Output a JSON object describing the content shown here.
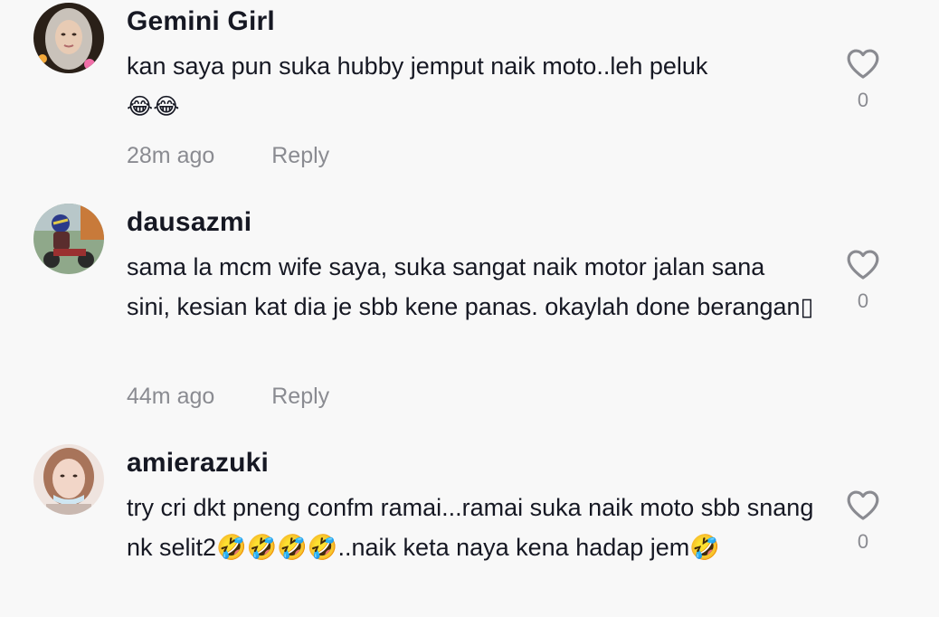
{
  "comments": [
    {
      "username": "Gemini Girl",
      "text": "kan saya pun suka hubby jemput naik moto..leh peluk",
      "emoji": "😂😂",
      "time": "28m ago",
      "reply_label": "Reply",
      "likes": "0",
      "avatar_icon": "hijab-girl-avatar"
    },
    {
      "username": "dausazmi",
      "text": "sama la mcm wife saya, suka sangat naik motor jalan sana sini, kesian kat dia je sbb kene panas. okaylah done berangan▯",
      "emoji": "",
      "time": "44m ago",
      "reply_label": "Reply",
      "likes": "0",
      "avatar_icon": "motorcycle-rider-avatar"
    },
    {
      "username": "amierazuki",
      "text": "try cri dkt pneng confm ramai...ramai suka naik moto sbb snang nk selit2🤣🤣🤣🤣..naik keta naya kena hadap jem🤣",
      "emoji": "",
      "time": "",
      "reply_label": "",
      "likes": "0",
      "avatar_icon": "girl-avatar"
    }
  ],
  "colors": {
    "background": "#f8f8f8",
    "text": "#161823",
    "muted": "#8a8b91"
  }
}
